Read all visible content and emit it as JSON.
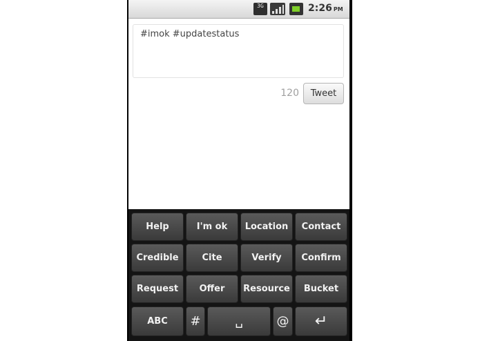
{
  "status_bar": {
    "network": "3G",
    "time": "2:26",
    "ampm": "PM",
    "icons": [
      "network-3g-icon",
      "signal-icon",
      "battery-icon"
    ]
  },
  "compose": {
    "text": "#imok #updatestatus",
    "counter": "120",
    "tweet_label": "Tweet"
  },
  "keyboard": {
    "rows": [
      [
        "Help",
        "I'm ok",
        "Location",
        "Contact"
      ],
      [
        "Credible",
        "Cite",
        "Verify",
        "Confirm"
      ],
      [
        "Request",
        "Offer",
        "Resource",
        "Bucket"
      ]
    ],
    "bottom": {
      "abc": "ABC",
      "hash": "#",
      "space": "␣",
      "at": "@",
      "enter": "↵"
    }
  }
}
